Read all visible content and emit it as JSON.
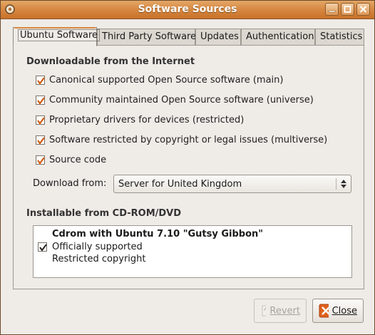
{
  "window": {
    "title": "Software Sources"
  },
  "tabs": [
    {
      "label": "Ubuntu Software",
      "active": true
    },
    {
      "label": "Third Party Software",
      "active": false
    },
    {
      "label": "Updates",
      "active": false
    },
    {
      "label": "Authentication",
      "active": false
    },
    {
      "label": "Statistics",
      "active": false
    }
  ],
  "internet": {
    "heading": "Downloadable from the Internet",
    "components": [
      {
        "label": "Canonical supported Open Source software (main)",
        "checked": true
      },
      {
        "label": "Community maintained Open Source software (universe)",
        "checked": true
      },
      {
        "label": "Proprietary drivers for devices (restricted)",
        "checked": true
      },
      {
        "label": "Software restricted by copyright or legal issues (multiverse)",
        "checked": true
      },
      {
        "label": "Source code",
        "checked": true
      }
    ],
    "download_from_label": "Download from:",
    "download_from_value": "Server for United Kingdom"
  },
  "cdrom": {
    "heading": "Installable from CD-ROM/DVD",
    "entry": {
      "title": "Cdrom with Ubuntu 7.10 \"Gutsy Gibbon\"",
      "line1": "Officially supported",
      "line2": "Restricted copyright",
      "checked": true
    }
  },
  "buttons": {
    "revert_label": "Revert",
    "close_label": "Close"
  },
  "colors": {
    "titlebar": "#d88a44",
    "checkmark": "#d15b11",
    "close_icon": "#e0601c"
  }
}
